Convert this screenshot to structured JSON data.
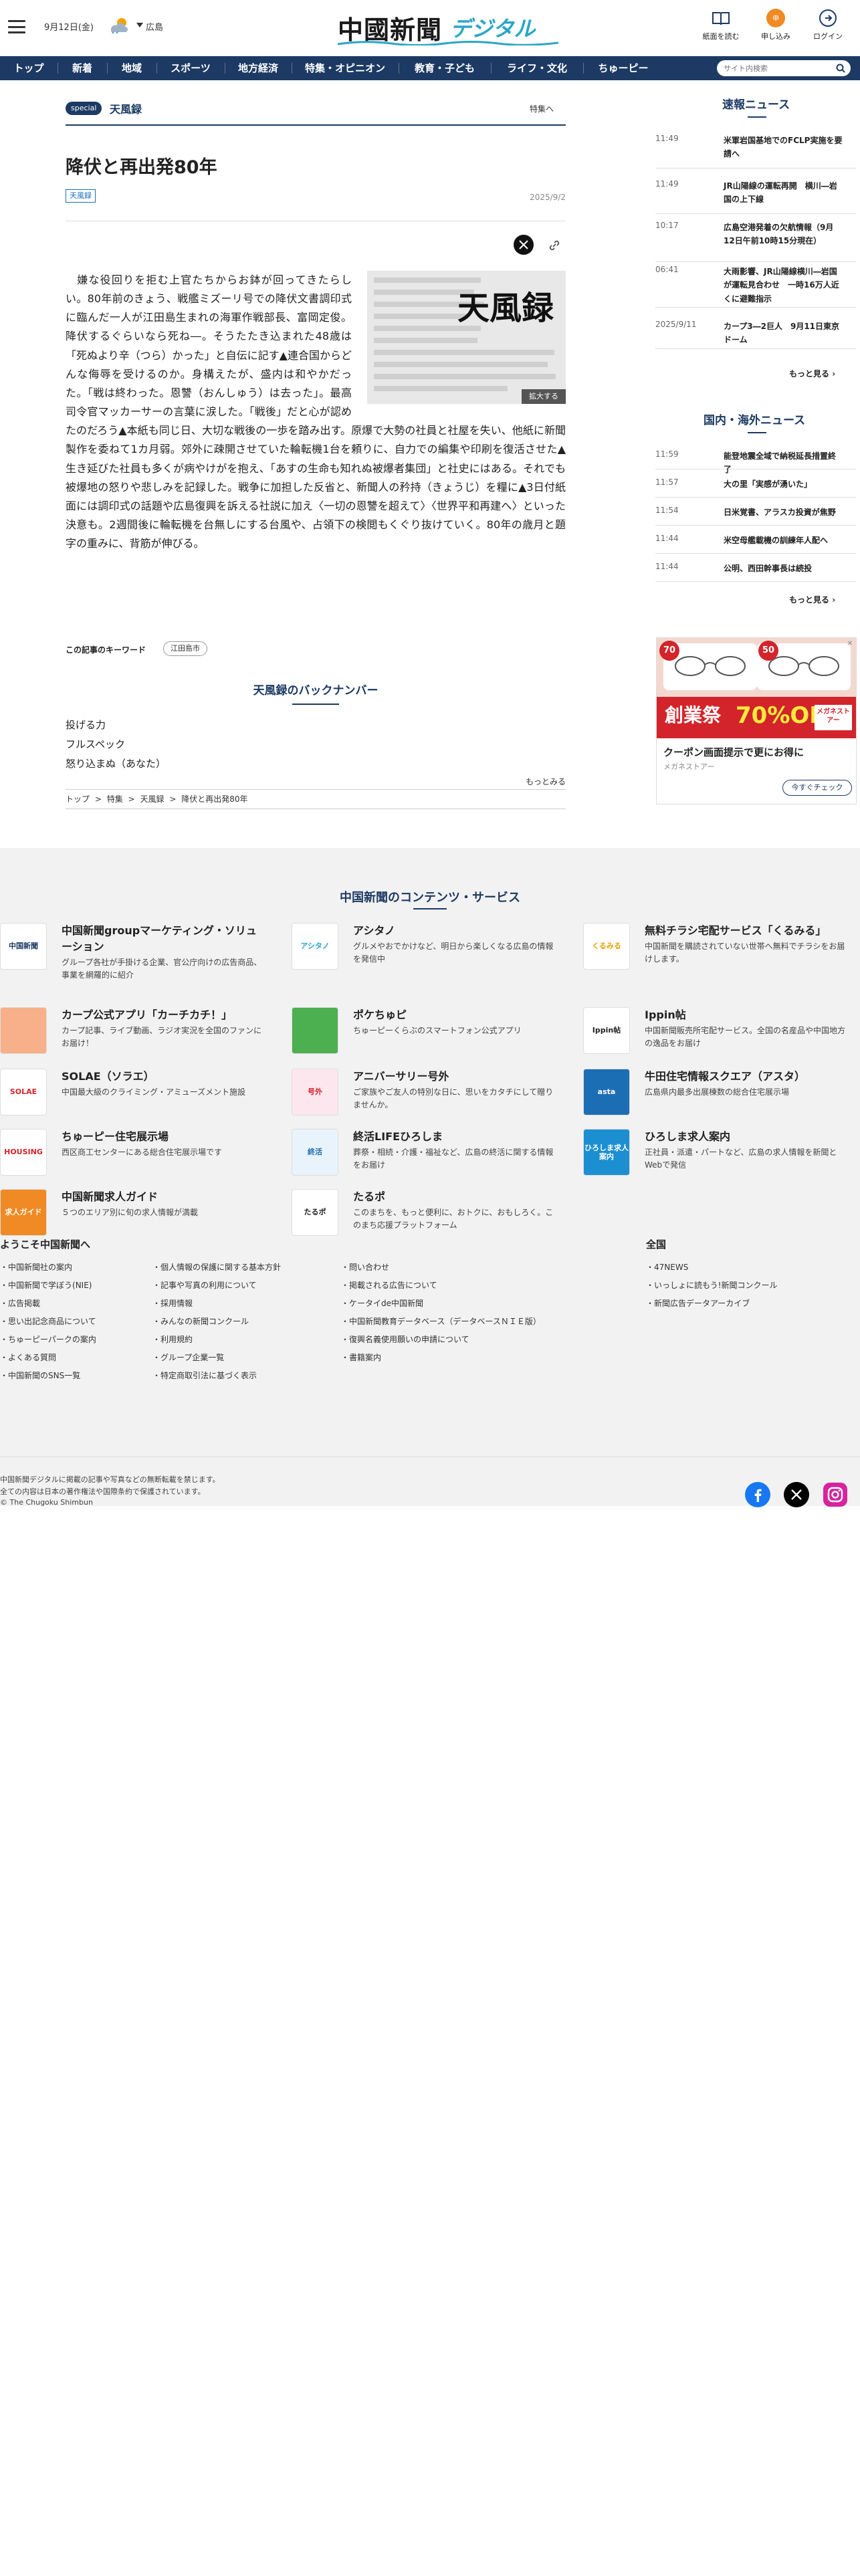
{
  "header": {
    "date": "9月12日(金)",
    "area": "広島",
    "logo_main": "中國新聞",
    "logo_sub": "デジタル",
    "buttons": [
      {
        "label": "紙面を読む"
      },
      {
        "label": "申し込み"
      },
      {
        "label": "ログイン"
      }
    ]
  },
  "nav": {
    "items": [
      "トップ",
      "新着",
      "地域",
      "スポーツ",
      "地方経済",
      "特集・オピニオン",
      "教育・子ども",
      "ライフ・文化",
      "ちゅーピー"
    ],
    "search_placeholder": "サイト内検索"
  },
  "article": {
    "badge": "special",
    "category": "天風録",
    "category_link": "特集へ",
    "title": "降伏と再出発80年",
    "tag": "天風録",
    "date": "2025/9/2",
    "figure_title": "天風録",
    "figure_zoom": "拡大する",
    "body": "　嫌な役回りを拒む上官たちからお鉢が回ってきたらしい。80年前のきょう、戦艦ミズーリ号での降伏文書調印式に臨んだ一人が江田島生まれの海軍作戦部長、富岡定俊。降伏するぐらいなら死ね―。そうたたき込まれた48歳は「死ぬより辛（つら）かった」と自伝に記す▲連合国からどんな侮辱を受けるのか。身構えたが、盛内は和やかだった。「戦は終わった。恩讐（おんしゅう）は去った」。最高司令官マッカーサーの言葉に涙した。「戦後」だと心が認めたのだろう▲本紙も同じ日、大切な戦後の一歩を踏み出す。原爆で大勢の社員と社屋を失い、他紙に新聞製作を委ねて1カ月弱。郊外に疎開させていた輪転機1台を頼りに、自力での編集や印刷を復活させた▲生き延びた社員も多くが病やけがを抱え、「あすの生命も知れぬ被爆者集団」と社史にはある。それでも被爆地の怒りや悲しみを記録した。戦争に加担した反省と、新聞人の矜持（きょうじ）を糧に▲3日付紙面には調印式の話題や広島復興を訴える社説に加え〈一切の恩讐を超えて〉〈世界平和再建へ〉といった決意も。2週間後に輪転機を台無しにする台風や、占領下の検閲もくぐり抜けていく。80年の歳月と題字の重みに、背筋が伸びる。",
    "keywords_label": "この記事のキーワード",
    "keyword": "江田島市",
    "backnumber_title": "天風録のバックナンバー",
    "backnumbers": [
      "投げる力",
      "フルスペック",
      "怒り込まぬ（あなた）"
    ],
    "more": "もっとみる",
    "breadcrumb": [
      "トップ",
      ">",
      "特集",
      ">",
      "天風録",
      ">",
      "降伏と再出発80年"
    ]
  },
  "sidebar": {
    "breaking_title": "速報ニュース",
    "breaking": [
      {
        "time": "11:49",
        "text": "米軍岩国基地でのFCLP実施を要請へ"
      },
      {
        "time": "11:49",
        "text": "JR山陽線の運転再開　横川―岩国の上下線"
      },
      {
        "time": "10:17",
        "text": "広島空港発着の欠航情報（9月12日午前10時15分現在）"
      },
      {
        "time": "06:41",
        "text": "大雨影響、JR山陽線横川―岩国が運転見合わせ　一時16万人近くに避難指示"
      },
      {
        "time": "2025/9/11",
        "text": "カープ3―2巨人　9月11日東京ドーム"
      }
    ],
    "breaking_more": "もっと見る",
    "world_title": "国内・海外ニュース",
    "world": [
      {
        "time": "11:59",
        "text": "能登地震全域で納税延長措置終了"
      },
      {
        "time": "11:57",
        "text": "大の里「実感が湧いた」"
      },
      {
        "time": "11:54",
        "text": "日米覚書、アラスカ投資が焦野"
      },
      {
        "time": "11:44",
        "text": "米空母艦載機の訓練年人配へ"
      },
      {
        "time": "11:44",
        "text": "公明、西田幹事長は続投"
      }
    ],
    "world_more": "もっと見る",
    "ad": {
      "badge_left": "70",
      "badge_right": "50",
      "banner_main": "創業祭",
      "banner_pct": "70%OFF",
      "banner_store": "メガネストアー",
      "headline": "クーポン画面提示で更にお得に",
      "sub": "メガネストアー",
      "cta": "今すぐチェック"
    }
  },
  "footer": {
    "services_title": "中国新聞のコンテンツ・サービス",
    "services": [
      {
        "name": "中国新聞groupマーケティング・ソリューション",
        "desc": "グループ各社が手掛ける企業、官公庁向けの広告商品、事業を網羅的に紹介",
        "logo": "中国新聞",
        "color": "#ffffff",
        "fg": "#1c3a63"
      },
      {
        "name": "アシタノ",
        "desc": "グルメやおでかけなど、明日から楽しくなる広島の情報を発信中",
        "logo": "アシタノ",
        "color": "#ffffff",
        "fg": "#2aa6c8"
      },
      {
        "name": "無料チラシ宅配サービス「くるみる」",
        "desc": "中国新聞を購読されていない世帯へ無料でチラシをお届けします。",
        "logo": "くるみる",
        "color": "#ffffff",
        "fg": "#e0a000"
      },
      {
        "name": "カープ公式アプリ「カーチカチ！」",
        "desc": "カープ記事、ライブ動画、ラジオ実況を全国のファンにお届け！",
        "logo": "",
        "color": "#f7b089",
        "fg": "#d3242b"
      },
      {
        "name": "ポケちゅピ",
        "desc": "ちゅーピーくらぶのスマートフォン公式アプリ",
        "logo": "",
        "color": "#4caf50",
        "fg": "#ffffff"
      },
      {
        "name": "Ippin帖",
        "desc": "中国新聞販売所宅配サービス。全国の名産品や中国地方の逸品をお届け",
        "logo": "Ippin帖",
        "color": "#ffffff",
        "fg": "#222222"
      },
      {
        "name": "SOLAE（ソラエ）",
        "desc": "中国最大級のクライミング・アミューズメント施設",
        "logo": "SOLAE",
        "color": "#ffffff",
        "fg": "#d3242b"
      },
      {
        "name": "アニバーサリー号外",
        "desc": "ご家族やご友人の特別な日に、思いをカタチにして贈りませんか。",
        "logo": "号外",
        "color": "#fde7ef",
        "fg": "#d3242b"
      },
      {
        "name": "牛田住宅情報スクエア（アスタ）",
        "desc": "広島県内最多出展棟数の総合住宅展示場",
        "logo": "asta",
        "color": "#1c6eb4",
        "fg": "#ffffff"
      },
      {
        "name": "ちゅーピー住宅展示場",
        "desc": "西区商工センターにある総合住宅展示場です",
        "logo": "HOUSING",
        "color": "#ffffff",
        "fg": "#d3242b"
      },
      {
        "name": "終活LIFEひろしま",
        "desc": "葬祭・相続・介護・福祉など、広島の終活に関する情報をお届け",
        "logo": "終活",
        "color": "#e9f3fb",
        "fg": "#1c6eb4"
      },
      {
        "name": "ひろしま求人案内",
        "desc": "正社員・派遣・パートなど、広島の求人情報を新聞とWebで発信",
        "logo": "ひろしま求人案内",
        "color": "#1c8fd1",
        "fg": "#ffffff"
      },
      {
        "name": "中国新聞求人ガイド",
        "desc": "５つのエリア別に旬の求人情報が満載",
        "logo": "求人ガイド",
        "color": "#f08a24",
        "fg": "#ffffff"
      },
      {
        "name": "たるポ",
        "desc": "このまちを、もっと便利に、おトクに、おもしろく。このまち応援プラットフォーム",
        "logo": "たるポ",
        "color": "#ffffff",
        "fg": "#222222"
      }
    ],
    "welcome_title": "ようこそ中国新聞へ",
    "national_title": "全国",
    "links_col1": [
      "中国新聞社の案内",
      "中国新聞で学ぼう(NIE)",
      "広告掲載",
      "思い出記念商品について",
      "ちゅーピーパークの案内",
      "よくある質問",
      "中国新聞のSNS一覧"
    ],
    "links_col2": [
      "個人情報の保護に関する基本方針",
      "記事や写真の利用について",
      "採用情報",
      "みんなの新聞コンクール",
      "利用規約",
      "グループ企業一覧",
      "特定商取引法に基づく表示"
    ],
    "links_col3": [
      "問い合わせ",
      "掲載される広告について",
      "ケータイde中国新聞",
      "中国新聞教育データベース（データベースＮＩＥ版）",
      "復興名義使用願いの申請について",
      "書籍案内"
    ],
    "links_col4": [
      "47NEWS",
      "いっしょに読もう!新聞コンクール",
      "新聞広告データアーカイブ"
    ],
    "copyright": [
      "中国新聞デジタルに掲載の記事や写真などの無断転載を禁じます。",
      "全ての内容は日本の著作権法や国際条約で保護されています。",
      "© The Chugoku Shimbun"
    ],
    "colors": {
      "facebook": "#1877f2",
      "x": "#000000",
      "instagram": "#d6249f"
    }
  }
}
